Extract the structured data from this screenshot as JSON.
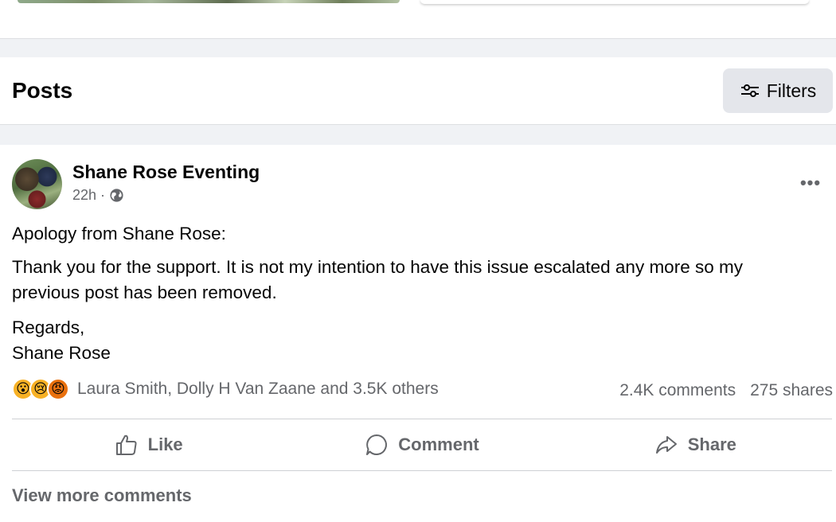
{
  "posts_header": {
    "title": "Posts",
    "filters_label": "Filters"
  },
  "post": {
    "author": "Shane Rose Eventing",
    "time": "22h",
    "separator": "·",
    "privacy_icon": "globe-icon",
    "more_label": "•••",
    "paragraphs": [
      "Apology from Shane Rose:",
      "Thank you for the support.  It is not my intention to have this issue escalated any more so my previous post has been removed.",
      "Regards,",
      "Shane Rose"
    ],
    "reactions": {
      "types": [
        "wow",
        "sad",
        "angry"
      ],
      "names": "Laura Smith, Dolly H Van Zaane and 3.5K others"
    },
    "comments_count": "2.4K comments",
    "shares_count": "275 shares",
    "actions": {
      "like": "Like",
      "comment": "Comment",
      "share": "Share"
    },
    "view_more_comments": "View more comments"
  },
  "colors": {
    "page_background": "#f0f2f5",
    "secondary_text": "#65676b",
    "button_background": "#e4e6eb",
    "reaction_yellow": "#f7b125",
    "reaction_angry": "#e9710f"
  }
}
